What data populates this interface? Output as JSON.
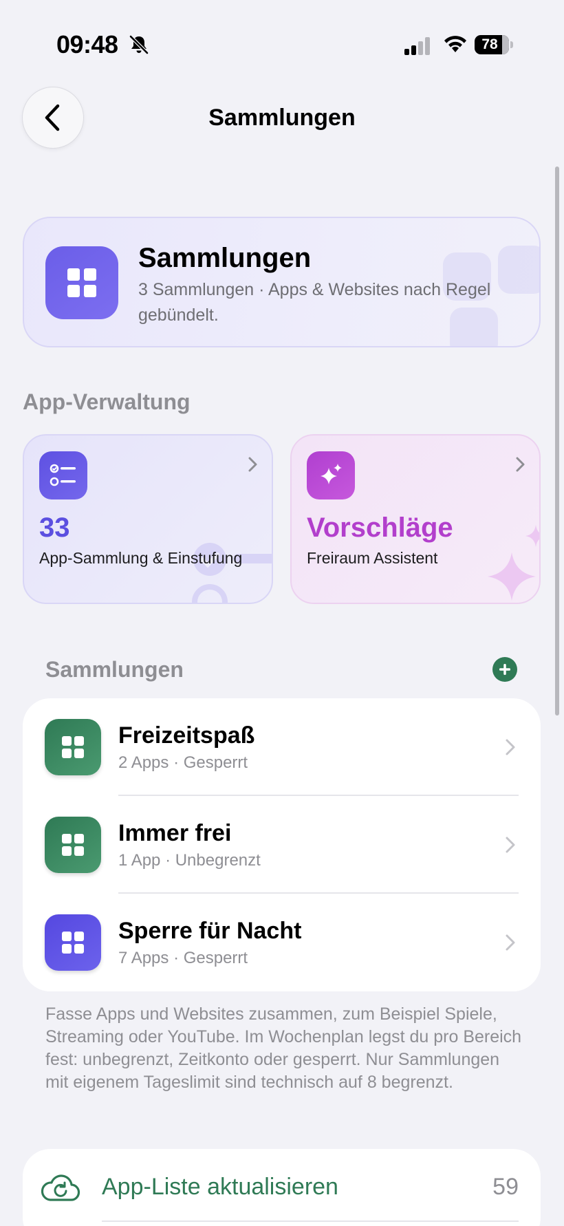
{
  "status_bar": {
    "time": "09:48",
    "battery": "78",
    "icons": [
      "bell-slash-icon",
      "signal-icon",
      "wifi-icon",
      "battery-icon"
    ]
  },
  "nav": {
    "title": "Sammlungen",
    "back_icon": "chevron-left-icon"
  },
  "hero": {
    "title": "Sammlungen",
    "subtitle": "3 Sammlungen · Apps & Websites nach Regel gebündelt.",
    "icon": "grid-icon",
    "accent": "#6b5ee8"
  },
  "app_management": {
    "section_label": "App-Verwaltung",
    "tiles": [
      {
        "value": "33",
        "subtitle": "App-Sammlung & Einstufung",
        "icon": "checklist-icon",
        "accent": "#5b4fe0"
      },
      {
        "title": "Vorschläge",
        "subtitle": "Freiraum Assistent",
        "icon": "sparkles-icon",
        "accent": "#b23fcc"
      }
    ]
  },
  "collections": {
    "section_label": "Sammlungen",
    "add_icon": "plus-icon",
    "items": [
      {
        "title": "Freizeitspaß",
        "subtitle": "2 Apps · Gesperrt",
        "color": "#3a8a62"
      },
      {
        "title": "Immer frei",
        "subtitle": "1 App · Unbegrenzt",
        "color": "#3a8a62"
      },
      {
        "title": "Sperre für Nacht",
        "subtitle": "7 Apps · Gesperrt",
        "color": "#5e55e6"
      }
    ],
    "footnote": "Fasse Apps und Websites zusammen, zum Beispiel Spiele, Streaming oder YouTube. Im Wochenplan legst du pro Bereich fest: unbegrenzt, Zeitkonto oder gesperrt. Nur Sammlungen mit eigenem Tageslimit sind technisch auf 8 begrenzt."
  },
  "update_list": {
    "label": "App-Liste aktualisieren",
    "count": "59",
    "icon": "cloud-refresh-icon",
    "accent": "#2f7a55"
  }
}
